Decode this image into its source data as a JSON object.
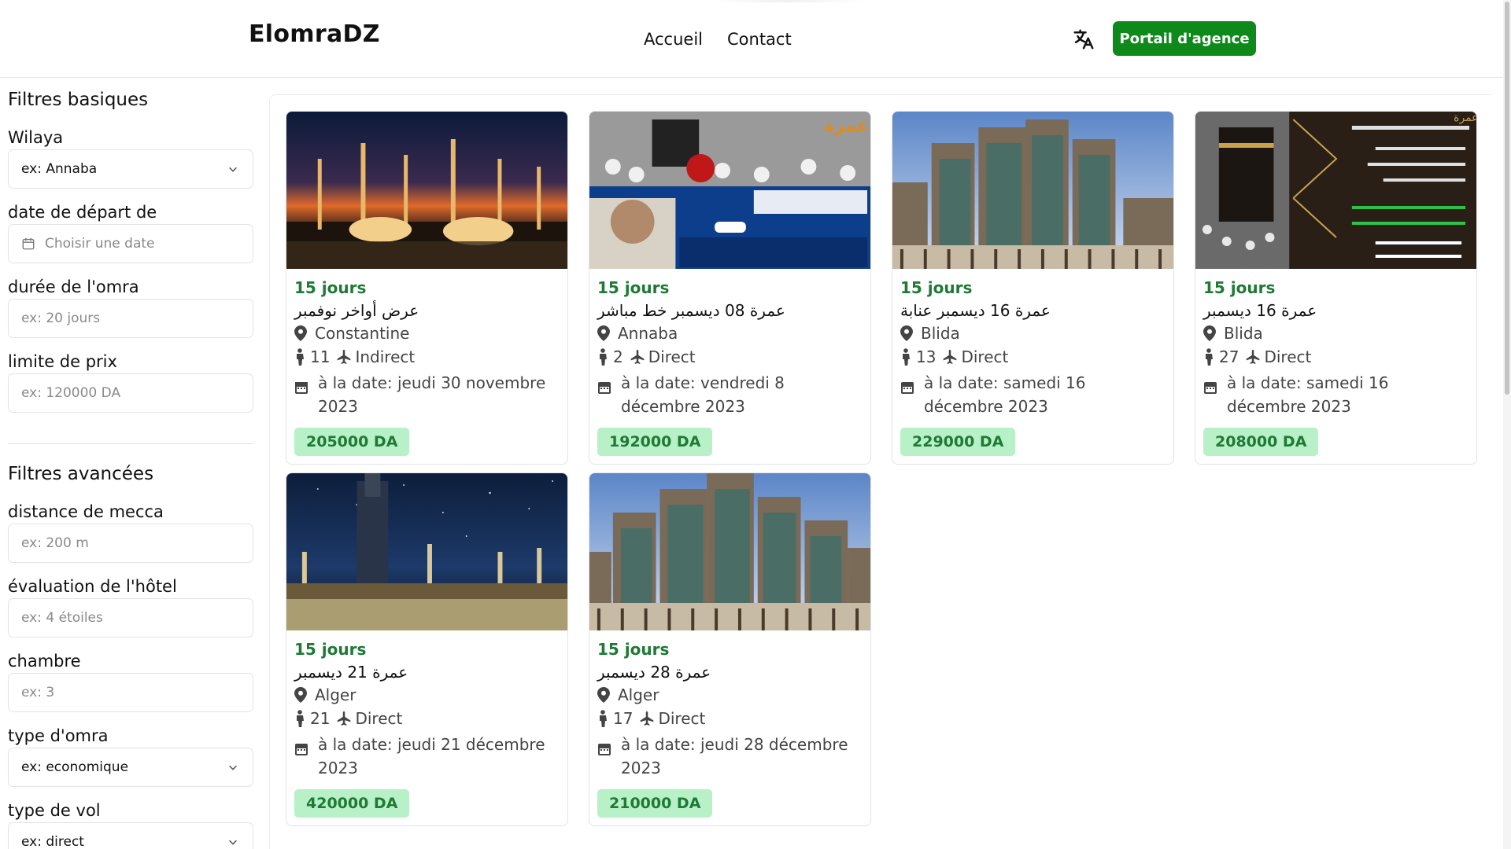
{
  "header": {
    "logo": "ElomraDZ",
    "nav": [
      "Accueil",
      "Contact"
    ],
    "portal_button": "Portail d'agence"
  },
  "sidebar": {
    "basic_title": "Filtres basiques",
    "advanced_title": "Filtres avancées",
    "wilaya": {
      "label": "Wilaya",
      "value": "ex: Annaba"
    },
    "date": {
      "label": "date de départ de",
      "placeholder": "Choisir une date"
    },
    "duration": {
      "label": "durée de l'omra",
      "placeholder": "ex: 20 jours"
    },
    "price": {
      "label": "limite de prix",
      "placeholder": "ex: 120000 DA"
    },
    "distance": {
      "label": "distance de mecca",
      "placeholder": "ex: 200 m"
    },
    "rating": {
      "label": "évaluation de l'hôtel",
      "placeholder": "ex: 4 étoiles"
    },
    "room": {
      "label": "chambre",
      "placeholder": "ex: 3"
    },
    "omra_type": {
      "label": "type d'omra",
      "value": "ex: economique"
    },
    "flight_type": {
      "label": "type de vol",
      "value": "ex: direct"
    }
  },
  "offers": [
    {
      "duration": "15 jours",
      "title": "عرض أواخر نوفمبر",
      "city": "Constantine",
      "pax": "11",
      "flight": "Indirect",
      "date": "à la date: jeudi 30 novembre 2023",
      "price": "205000 DA",
      "image": "medina-night"
    },
    {
      "duration": "15 jours",
      "title": "عمرة 08 ديسمبر خط مباشر",
      "city": "Annaba",
      "pax": "2",
      "flight": "Direct",
      "date": "à la date: vendredi 8 décembre 2023",
      "price": "192000 DA",
      "image": "najah-poster"
    },
    {
      "duration": "15 jours",
      "title": "عمرة 16 ديسمبر عنابة",
      "city": "Blida",
      "pax": "13",
      "flight": "Direct",
      "date": "à la date: samedi 16 décembre 2023",
      "price": "229000 DA",
      "image": "clock-towers"
    },
    {
      "duration": "15 jours",
      "title": "عمرة 16 ديسمبر",
      "city": "Blida",
      "pax": "27",
      "flight": "Direct",
      "date": "à la date: samedi 16 décembre 2023",
      "price": "208000 DA",
      "image": "kaaba-poster"
    },
    {
      "duration": "15 jours",
      "title": "عمرة 21 ديسمبر",
      "city": "Alger",
      "pax": "21",
      "flight": "Direct",
      "date": "à la date: jeudi 21 décembre 2023",
      "price": "420000 DA",
      "image": "mecca-stars"
    },
    {
      "duration": "15 jours",
      "title": "عمرة 28 ديسمبر",
      "city": "Alger",
      "pax": "17",
      "flight": "Direct",
      "date": "à la date: jeudi 28 décembre 2023",
      "price": "210000 DA",
      "image": "clock-towers"
    }
  ],
  "icons": {
    "translate": "translate-icon",
    "location": "map-pin-icon",
    "person": "person-icon",
    "plane": "plane-icon",
    "calendar": "calendar-icon",
    "chevron": "chevron-down-icon"
  },
  "colors": {
    "brand_green": "#0d8a1a",
    "duration_green": "#1e7a34",
    "price_bg": "#b8f0c8"
  }
}
